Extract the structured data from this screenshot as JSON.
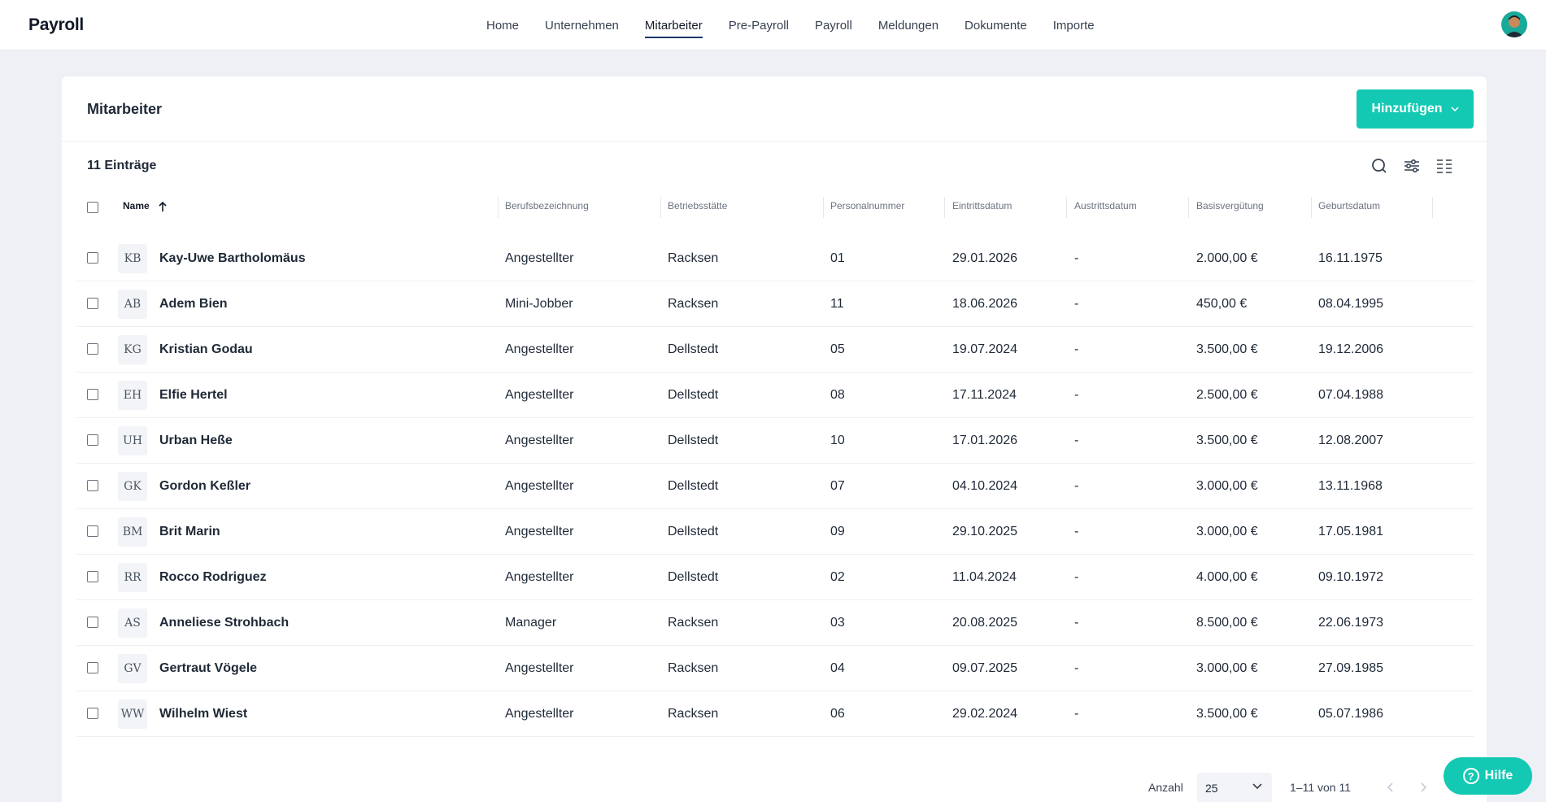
{
  "app": {
    "brand": "Payroll"
  },
  "nav": {
    "items": [
      "Home",
      "Unternehmen",
      "Mitarbeiter",
      "Pre-Payroll",
      "Payroll",
      "Meldungen",
      "Dokumente",
      "Importe"
    ],
    "active": "Mitarbeiter"
  },
  "page": {
    "title": "Mitarbeiter",
    "add_button": "Hinzufügen",
    "entry_count": "11 Einträge"
  },
  "table": {
    "columns": [
      "Name",
      "Berufsbezeichnung",
      "Betriebsstätte",
      "Personalnummer",
      "Eintrittsdatum",
      "Austrittsdatum",
      "Basisvergütung",
      "Geburtsdatum"
    ],
    "sort": {
      "column": "Name",
      "direction": "ascending"
    },
    "rows": [
      {
        "initials": "KB",
        "name": "Kay-Uwe Bartholomäus",
        "job": "Angestellter",
        "site": "Racksen",
        "number": "01",
        "entry": "29.01.2026",
        "exit": "-",
        "salary": "2.000,00 €",
        "birth": "16.11.1975"
      },
      {
        "initials": "AB",
        "name": "Adem Bien",
        "job": "Mini-Jobber",
        "site": "Racksen",
        "number": "11",
        "entry": "18.06.2026",
        "exit": "-",
        "salary": "450,00 €",
        "birth": "08.04.1995"
      },
      {
        "initials": "KG",
        "name": "Kristian Godau",
        "job": "Angestellter",
        "site": "Dellstedt",
        "number": "05",
        "entry": "19.07.2024",
        "exit": "-",
        "salary": "3.500,00 €",
        "birth": "19.12.2006"
      },
      {
        "initials": "EH",
        "name": "Elfie Hertel",
        "job": "Angestellter",
        "site": "Dellstedt",
        "number": "08",
        "entry": "17.11.2024",
        "exit": "-",
        "salary": "2.500,00 €",
        "birth": "07.04.1988"
      },
      {
        "initials": "UH",
        "name": "Urban Heße",
        "job": "Angestellter",
        "site": "Dellstedt",
        "number": "10",
        "entry": "17.01.2026",
        "exit": "-",
        "salary": "3.500,00 €",
        "birth": "12.08.2007"
      },
      {
        "initials": "GK",
        "name": "Gordon Keßler",
        "job": "Angestellter",
        "site": "Dellstedt",
        "number": "07",
        "entry": "04.10.2024",
        "exit": "-",
        "salary": "3.000,00 €",
        "birth": "13.11.1968"
      },
      {
        "initials": "BM",
        "name": "Brit Marin",
        "job": "Angestellter",
        "site": "Dellstedt",
        "number": "09",
        "entry": "29.10.2025",
        "exit": "-",
        "salary": "3.000,00 €",
        "birth": "17.05.1981"
      },
      {
        "initials": "RR",
        "name": "Rocco Rodriguez",
        "job": "Angestellter",
        "site": "Dellstedt",
        "number": "02",
        "entry": "11.04.2024",
        "exit": "-",
        "salary": "4.000,00 €",
        "birth": "09.10.1972"
      },
      {
        "initials": "AS",
        "name": "Anneliese Strohbach",
        "job": "Manager",
        "site": "Racksen",
        "number": "03",
        "entry": "20.08.2025",
        "exit": "-",
        "salary": "8.500,00 €",
        "birth": "22.06.1973"
      },
      {
        "initials": "GV",
        "name": "Gertraut Vögele",
        "job": "Angestellter",
        "site": "Racksen",
        "number": "04",
        "entry": "09.07.2025",
        "exit": "-",
        "salary": "3.000,00 €",
        "birth": "27.09.1985"
      },
      {
        "initials": "WW",
        "name": "Wilhelm Wiest",
        "job": "Angestellter",
        "site": "Racksen",
        "number": "06",
        "entry": "29.02.2024",
        "exit": "-",
        "salary": "3.500,00 €",
        "birth": "05.07.1986"
      }
    ]
  },
  "pagination": {
    "page_size_label": "Anzahl",
    "page_size": "25",
    "range": "1–11 von 11"
  },
  "help": {
    "label": "Hilfe"
  },
  "colors": {
    "accent": "#14c9b3",
    "nav_indicator": "#1b3a6b",
    "background": "#eef0f6"
  },
  "icons": [
    "search-icon",
    "filter-icon",
    "columns-icon",
    "sort-ascending-icon",
    "chevron-down-icon",
    "chevron-left-icon",
    "chevron-right-icon",
    "help-circle-icon"
  ]
}
